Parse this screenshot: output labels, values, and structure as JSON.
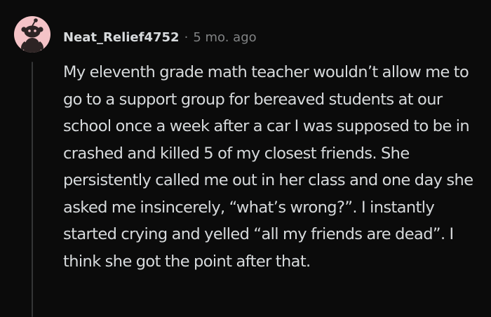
{
  "comment": {
    "author": "Neat_Relief4752",
    "separator": "·",
    "time_ago": "5 mo. ago",
    "body": "My eleventh grade math teacher wouldn’t allow me to go to a support group for bereaved students at our school once a week after a car I was supposed to be in crashed and killed 5 of my closest friends. She persistently called me out in her class and one day she asked me insincerely, “what’s wrong?”. I instantly started crying and yelled “all my friends are dead”. I think she got the point after that.",
    "avatar_icon": "reddit-snoo-avatar-icon"
  },
  "colors": {
    "background": "#0b0b0b",
    "text": "#d7dadc",
    "meta": "#818384",
    "avatar_bg": "#f4c3c7",
    "avatar_figure": "#2d2424",
    "thread_line": "#343536"
  }
}
